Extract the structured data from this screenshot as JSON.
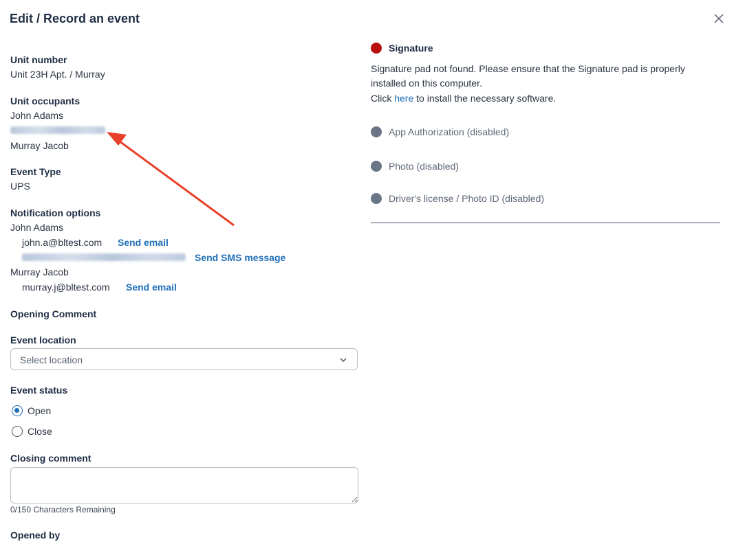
{
  "dialog": {
    "title": "Edit / Record an event"
  },
  "unit_number": {
    "label": "Unit number",
    "value": "Unit 23H Apt. / Murray"
  },
  "unit_occupants": {
    "label": "Unit occupants",
    "names": [
      "John Adams",
      "Murray Jacob"
    ]
  },
  "event_type": {
    "label": "Event Type",
    "value": "UPS"
  },
  "notification": {
    "label": "Notification options",
    "person1": {
      "name": "John Adams",
      "email": "john.a@bltest.com",
      "email_action": "Send email",
      "sms_action": "Send SMS message"
    },
    "person2": {
      "name": "Murray Jacob",
      "email": "murray.j@bltest.com",
      "email_action": "Send email"
    }
  },
  "opening_comment": {
    "label": "Opening Comment"
  },
  "event_location": {
    "label": "Event location",
    "placeholder": "Select location"
  },
  "event_status": {
    "label": "Event status",
    "options": [
      "Open",
      "Close"
    ],
    "selected": "Open"
  },
  "closing_comment": {
    "label": "Closing comment",
    "counter": "0/150 Characters Remaining"
  },
  "opened_by": {
    "label": "Opened by"
  },
  "right": {
    "signature": {
      "label": "Signature",
      "message_line1": "Signature pad not found. Please ensure that the Signature pad is properly",
      "message_line2": "installed on this computer.",
      "click_prefix": "Click",
      "click_link": "here",
      "click_suffix": "to install the necessary software."
    },
    "app_auth": "App Authorization (disabled)",
    "photo": "Photo (disabled)",
    "license": "Driver's license / Photo ID (disabled)"
  },
  "colors": {
    "signature_dot": "#b80f0f",
    "disabled_dot": "#6a7587",
    "link": "#1f6fb8",
    "arrow": "#e8402a"
  }
}
